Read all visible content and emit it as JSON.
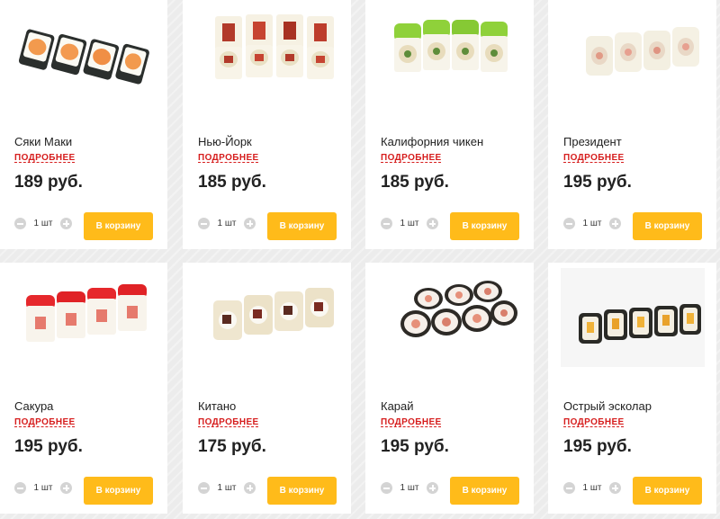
{
  "products": [
    {
      "name": "Сяки Маки",
      "more": "ПОДРОБНЕЕ",
      "price": "189 руб.",
      "qty": "1 шт",
      "button": "В корзину",
      "image": "salmon-maki-rolls"
    },
    {
      "name": "Нью-Йорк",
      "more": "ПОДРОБНЕЕ",
      "price": "185 руб.",
      "qty": "1 шт",
      "button": "В корзину",
      "image": "new-york-rolls"
    },
    {
      "name": "Калифорния чикен",
      "more": "ПОДРОБНЕЕ",
      "price": "185 руб.",
      "qty": "1 шт",
      "button": "В корзину",
      "image": "california-chicken-rolls"
    },
    {
      "name": "Президент",
      "more": "ПОДРОБНЕЕ",
      "price": "195 руб.",
      "qty": "1 шт",
      "button": "В корзину",
      "image": "president-rolls"
    },
    {
      "name": "Сакура",
      "more": "ПОДРОБНЕЕ",
      "price": "195 руб.",
      "qty": "1 шт",
      "button": "В корзину",
      "image": "sakura-rolls"
    },
    {
      "name": "Китано",
      "more": "ПОДРОБНЕЕ",
      "price": "175 руб.",
      "qty": "1 шт",
      "button": "В корзину",
      "image": "kitano-rolls"
    },
    {
      "name": "Карай",
      "more": "ПОДРОБНЕЕ",
      "price": "195 руб.",
      "qty": "1 шт",
      "button": "В корзину",
      "image": "karai-rolls"
    },
    {
      "name": "Острый эсколар",
      "more": "ПОДРОБНЕЕ",
      "price": "195 руб.",
      "qty": "1 шт",
      "button": "В корзину",
      "image": "spicy-escolar-rolls"
    }
  ],
  "colors": {
    "accent": "#ffbb1a",
    "link": "#d61d1d",
    "page_background": "#ececec",
    "card_background": "#ffffff"
  }
}
